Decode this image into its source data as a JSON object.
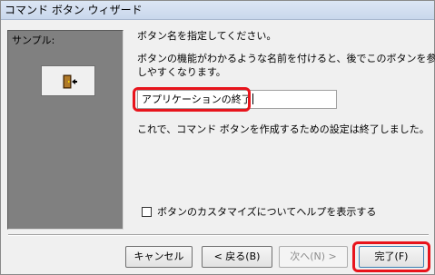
{
  "window": {
    "title": "コマンド ボタン ウィザード"
  },
  "sample": {
    "label": "サンプル:",
    "button_icon": "exit-door-icon"
  },
  "instructions": {
    "line1": "ボタン名を指定してください。",
    "line2": "ボタンの機能がわかるような名前を付けると、後でこのボタンを参照",
    "line3": "しやすくなります。",
    "line4": "これで、コマンド ボタンを作成するための設定は終了しました。"
  },
  "name_field": {
    "value": "アプリケーションの終了"
  },
  "help_checkbox": {
    "label": "ボタンのカスタマイズについてヘルプを表示する",
    "checked": false
  },
  "buttons": {
    "cancel": "キャンセル",
    "back": "< 戻る(B)",
    "next": "次へ(N) >",
    "finish": "完了(F)"
  },
  "colors": {
    "highlight": "#e8141c",
    "sample_panel": "#808080"
  }
}
